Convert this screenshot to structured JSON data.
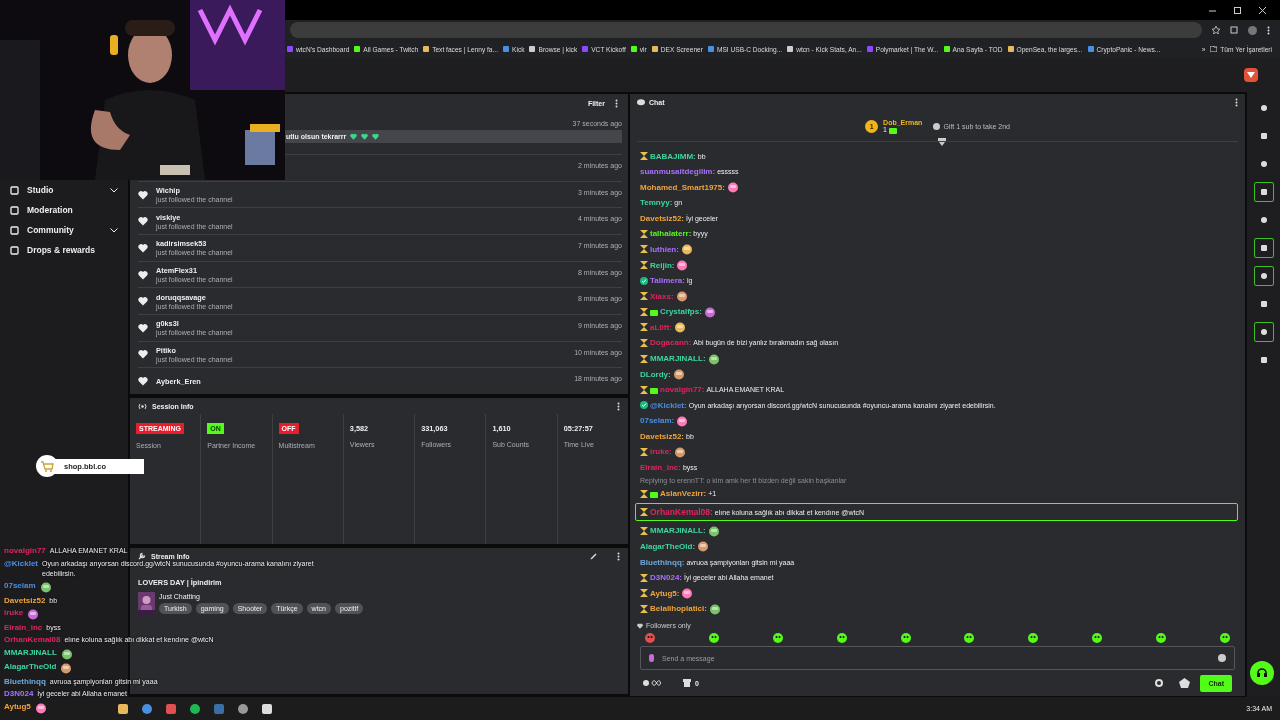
{
  "browser": {
    "bookmarks": [
      "wtcN's Dashboard",
      "All Games - Twitch",
      "Text faces | Lenny fa...",
      "Kick",
      "Browse | kick",
      "VCT Kickoff",
      "vlr",
      "DEX Screener",
      "MSI USB-C Docking...",
      "wtcn - Kick Stats, An...",
      "Polymarket | The W...",
      "Ana Sayfa - TOD",
      "OpenSea, the larges...",
      "CryptoPanic - News..."
    ],
    "more": "»",
    "all_bookmarks": "Tüm Yer İşaretleri"
  },
  "sidebar": {
    "items": [
      {
        "label": "Studio",
        "kind": "group"
      },
      {
        "label": "Moderation",
        "kind": "link"
      },
      {
        "label": "Community",
        "kind": "group"
      },
      {
        "label": "Drops & rewards",
        "kind": "link"
      }
    ]
  },
  "activity": {
    "filter": "Filter",
    "items": [
      {
        "kind": "message",
        "text": "utlu olsun tekrarrr",
        "time": "37 seconds ago"
      },
      {
        "kind": "hidden",
        "time": "2 minutes ago"
      },
      {
        "kind": "follow",
        "name": "Wichip",
        "detail": "just followed the channel",
        "time": "3 minutes ago"
      },
      {
        "kind": "follow",
        "name": "viskiye",
        "detail": "just followed the channel",
        "time": "4 minutes ago"
      },
      {
        "kind": "follow",
        "name": "kadirsimsek53",
        "detail": "just followed the channel",
        "time": "7 minutes ago"
      },
      {
        "kind": "follow",
        "name": "AtemFlex31",
        "detail": "just followed the channel",
        "time": "8 minutes ago"
      },
      {
        "kind": "follow",
        "name": "doruqqsavage",
        "detail": "just followed the channel",
        "time": "8 minutes ago"
      },
      {
        "kind": "follow",
        "name": "g0ks3l",
        "detail": "just followed the channel",
        "time": "9 minutes ago"
      },
      {
        "kind": "follow",
        "name": "Pitiko",
        "detail": "just followed the channel",
        "time": "10 minutes ago"
      },
      {
        "kind": "follow",
        "name": "Ayberk_Eren",
        "time": "18 minutes ago"
      }
    ]
  },
  "session": {
    "title": "Session Info",
    "stats": [
      {
        "kind": "status",
        "value": "STREAMING",
        "color": "#e91c2c",
        "label": "Session"
      },
      {
        "kind": "status",
        "value": "ON",
        "color": "#53fc18",
        "label": "Partner Income"
      },
      {
        "kind": "status",
        "value": "OFF",
        "color": "#e91c2c",
        "label": "Multistream"
      },
      {
        "kind": "count",
        "value": "3,582",
        "label": "Viewers"
      },
      {
        "kind": "count",
        "value": "331,063",
        "label": "Followers"
      },
      {
        "kind": "count",
        "value": "1,610",
        "label": "Sub Counts"
      },
      {
        "kind": "count",
        "value": "05:27:57",
        "label": "Time Live"
      }
    ]
  },
  "stream_info": {
    "title": "Stream Info",
    "stream_title": "LOVERS DAY | İpindirim",
    "category": "Just Chatting",
    "tags": [
      "Turkish",
      "gaming",
      "Shooter",
      "Türkçe",
      "wtcn",
      "pozitif"
    ]
  },
  "chat": {
    "title": "Chat",
    "leader": {
      "rank": "1",
      "name": "Dob_Erman",
      "gifts": "1",
      "hint": "Gift 1 sub to take 2nd"
    },
    "messages": [
      {
        "name": "BABAJIMM:",
        "color": "#3dd6a0",
        "mod": true,
        "gifter": false,
        "verified": false,
        "kind": "text",
        "text": "bb"
      },
      {
        "name": "suanmusaitdegilim:",
        "color": "#a970ff",
        "mod": false,
        "gifter": false,
        "verified": false,
        "kind": "text",
        "text": "esssss"
      },
      {
        "name": "Mohamed_Smart1975:",
        "color": "#f2a33a",
        "mod": false,
        "gifter": false,
        "verified": false,
        "kind": "emote"
      },
      {
        "name": "Temnyy:",
        "color": "#3dd6a0",
        "mod": false,
        "gifter": false,
        "verified": false,
        "kind": "text",
        "text": "gn"
      },
      {
        "name": "Davetsiz52:",
        "color": "#f2a33a",
        "mod": false,
        "gifter": false,
        "verified": false,
        "kind": "text",
        "text": "İyi geceler"
      },
      {
        "name": "talhalaterr:",
        "color": "#53fc18",
        "mod": true,
        "gifter": false,
        "verified": false,
        "kind": "text",
        "text": "byyy"
      },
      {
        "name": "luthien:",
        "color": "#a970ff",
        "mod": true,
        "gifter": false,
        "verified": false,
        "kind": "emote"
      },
      {
        "name": "Reijin:",
        "color": "#3dd6a0",
        "mod": true,
        "gifter": false,
        "verified": false,
        "kind": "emote"
      },
      {
        "name": "Talimera:",
        "color": "#a970ff",
        "mod": false,
        "gifter": false,
        "verified": true,
        "kind": "text",
        "text": "lg"
      },
      {
        "name": "Xiaxs:",
        "color": "#e0245e",
        "mod": true,
        "gifter": false,
        "verified": false,
        "kind": "emote"
      },
      {
        "name": "Crystalfps:",
        "color": "#3dd6a0",
        "mod": true,
        "gifter": true,
        "verified": false,
        "kind": "emote"
      },
      {
        "name": "aL0ft:",
        "color": "#e0245e",
        "mod": true,
        "gifter": false,
        "verified": false,
        "kind": "emote"
      },
      {
        "name": "Dogacann:",
        "color": "#e0245e",
        "mod": true,
        "gifter": false,
        "verified": false,
        "kind": "text",
        "text": "Abi bugün de bizi yanlız bırakmadın sağ olasın"
      },
      {
        "name": "MMARJINALL:",
        "color": "#3dd6a0",
        "mod": true,
        "gifter": false,
        "verified": false,
        "kind": "emote"
      },
      {
        "name": "DLordy:",
        "color": "#3dd6a0",
        "mod": false,
        "gifter": false,
        "verified": false,
        "kind": "emote"
      },
      {
        "name": "novalgin77:",
        "color": "#e0245e",
        "mod": true,
        "gifter": true,
        "verified": false,
        "kind": "text",
        "text": "ALLAHA EMANET KRAL"
      },
      {
        "name": "@Kicklet:",
        "color": "#4a90e2",
        "mod": false,
        "gifter": false,
        "verified": true,
        "kind": "text",
        "text": "Oyun arkadaşı arıyorsan discord.gg/wtcN sunucusunda #oyuncu-arama kanalını ziyaret edebilirsin."
      },
      {
        "name": "07selam:",
        "color": "#4a90e2",
        "mod": false,
        "gifter": false,
        "verified": false,
        "kind": "emote"
      },
      {
        "name": "Davetsiz52:",
        "color": "#f2a33a",
        "mod": false,
        "gifter": false,
        "verified": false,
        "kind": "text",
        "text": "bb"
      },
      {
        "name": "iruke:",
        "color": "#e0245e",
        "mod": true,
        "gifter": false,
        "verified": false,
        "kind": "emote"
      },
      {
        "name": "Elrain_inc:",
        "color": "#e0245e",
        "mod": false,
        "gifter": false,
        "verified": false,
        "kind": "text",
        "text": "byss"
      },
      {
        "name": "AslanVezirr:",
        "color": "#f2a33a",
        "mod": true,
        "gifter": true,
        "verified": false,
        "kind": "text",
        "text": "+1",
        "reply": "Replying to erennTT: o kim amk her tt bizden değil sakin başkanlar"
      },
      {
        "name": "OrhanKemal08:",
        "color": "#e0245e",
        "mod": true,
        "gifter": false,
        "verified": false,
        "kind": "text",
        "text": "elıne koluna sağlık abı dikkat et kendıne @wtcN",
        "highlighted": true
      },
      {
        "name": "MMARJINALL:",
        "color": "#3dd6a0",
        "mod": true,
        "gifter": false,
        "verified": false,
        "kind": "emote"
      },
      {
        "name": "AlagarTheOld:",
        "color": "#3dd6a0",
        "mod": false,
        "gifter": false,
        "verified": false,
        "kind": "emote"
      },
      {
        "name": "Bluethinqq:",
        "color": "#6fa8dc",
        "mod": false,
        "gifter": false,
        "verified": false,
        "kind": "text",
        "text": "avruoa şampiyonları gitsin mi yaaa"
      },
      {
        "name": "D3N024:",
        "color": "#a970ff",
        "mod": true,
        "gifter": false,
        "verified": false,
        "kind": "text",
        "text": "İyi geceler abi Allaha emanet"
      },
      {
        "name": "Aytug5:",
        "color": "#f2a33a",
        "mod": true,
        "gifter": false,
        "verified": false,
        "kind": "emote"
      },
      {
        "name": "Belalihoplatici:",
        "color": "#f2a33a",
        "mod": true,
        "gifter": false,
        "verified": false,
        "kind": "emote"
      }
    ],
    "mode": "Followers only",
    "placeholder": "Send a message",
    "shop_count": "0",
    "send": "Chat"
  },
  "rail": [
    {
      "highlighted": false
    },
    {
      "highlighted": false
    },
    {
      "highlighted": false
    },
    {
      "highlighted": true
    },
    {
      "highlighted": false
    },
    {
      "highlighted": true
    },
    {
      "highlighted": true
    },
    {
      "highlighted": false
    },
    {
      "highlighted": true
    },
    {
      "highlighted": false
    }
  ],
  "overlay": {
    "shop": "shop.bbl.co",
    "chat": [
      {
        "name": "novalgin77",
        "color": "#e0245e",
        "kind": "text",
        "text": "ALLAHA EMANET KRAL"
      },
      {
        "name": "@Kicklet",
        "color": "#4a90e2",
        "kind": "text",
        "text": "Oyun arkadaşı arıyorsan discord.gg/wtcN sunucusunda #oyuncu-arama kanalını ziyaret edebilirsin."
      },
      {
        "name": "07selam",
        "color": "#4a90e2",
        "kind": "emote"
      },
      {
        "name": "Davetsiz52",
        "color": "#f2a33a",
        "kind": "text",
        "text": "bb"
      },
      {
        "name": "iruke",
        "color": "#e0245e",
        "kind": "emote"
      },
      {
        "name": "Elrain_inc",
        "color": "#e0245e",
        "kind": "text",
        "text": "byss"
      },
      {
        "name": "OrhanKemal08",
        "color": "#e0245e",
        "kind": "text",
        "text": "elıne koluna sağlık abı dikkat et kendıne @wtcN"
      },
      {
        "name": "MMARJINALL",
        "color": "#3dd6a0",
        "kind": "emote"
      },
      {
        "name": "AlagarTheOld",
        "color": "#3dd6a0",
        "kind": "emote"
      },
      {
        "name": "Bluethinqq",
        "color": "#6fa8dc",
        "kind": "text",
        "text": "avruoa şampiyonları gitsin mi yaaa"
      },
      {
        "name": "D3N024",
        "color": "#a970ff",
        "kind": "text",
        "text": "İyi geceler abi Allaha emanet"
      },
      {
        "name": "Aytug5",
        "color": "#f2a33a",
        "kind": "emote"
      }
    ]
  },
  "taskbar": {
    "time": "3:34 AM"
  }
}
